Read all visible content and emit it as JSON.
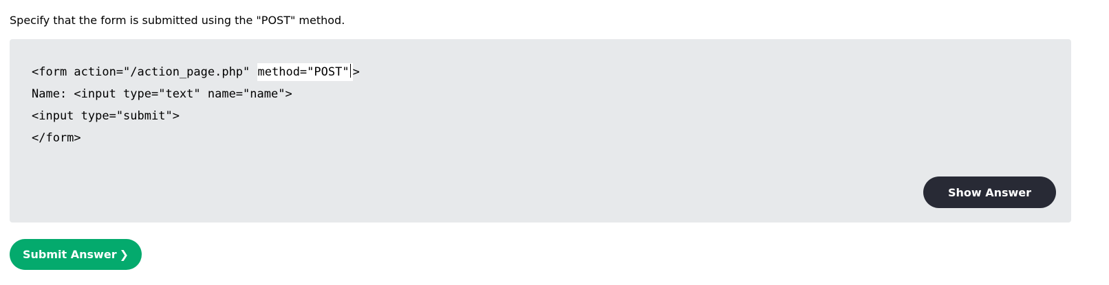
{
  "instruction": "Specify that the form is submitted using the \"POST\" method.",
  "code": {
    "line1_prefix": "<form action=\"/action_page.php\" ",
    "line1_input_value": "method=\"POST\"",
    "line1_suffix": ">",
    "line2": "Name: <input type=\"text\" name=\"name\">",
    "line3": "<input type=\"submit\">",
    "line4": "</form>"
  },
  "buttons": {
    "show_answer": "Show Answer",
    "submit_answer": "Submit Answer",
    "submit_chevron": "❯"
  },
  "colors": {
    "exercise_bg": "#e7e9eb",
    "show_answer_bg": "#282a35",
    "submit_bg": "#04aa6d"
  }
}
